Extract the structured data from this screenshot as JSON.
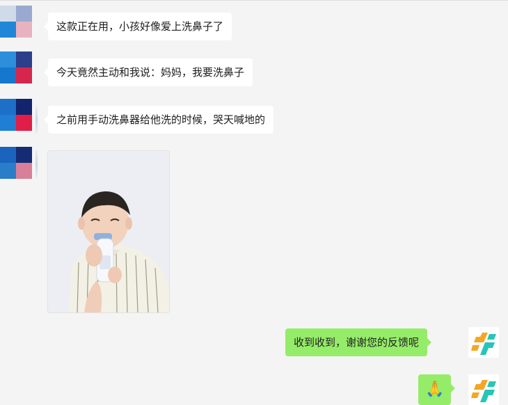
{
  "messages": [
    {
      "direction": "in",
      "text": "这款正在用，小孩好像爱上洗鼻子了"
    },
    {
      "direction": "in",
      "text": "今天竟然主动和我说：妈妈，我要洗鼻子"
    },
    {
      "direction": "in",
      "text": "之前用手动洗鼻器给他洗的时候，哭天喊地的"
    },
    {
      "direction": "in",
      "type": "image",
      "image_icon": "child-photo"
    },
    {
      "direction": "out",
      "text": "收到收到，谢谢您的反馈呢"
    },
    {
      "direction": "out",
      "type": "emoji",
      "emoji": "🙏"
    }
  ],
  "colors": {
    "background": "#f4f4f4",
    "incoming_bubble": "#ffffff",
    "outgoing_bubble": "#95ec69",
    "logo_orange": "#f5a623",
    "logo_teal": "#26c6b5"
  }
}
